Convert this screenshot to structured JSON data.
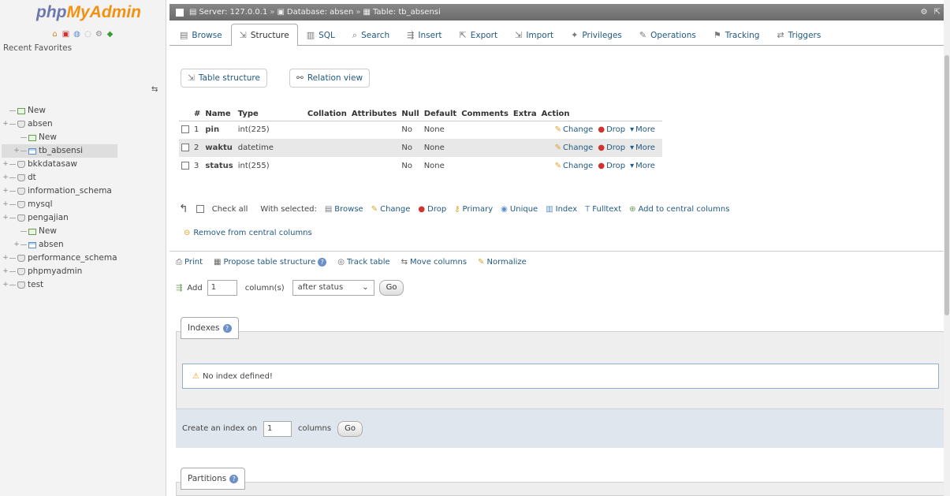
{
  "sidebar": {
    "logo_php": "php",
    "logo_myadmin": "MyAdmin",
    "recent_favorites": "Recent  Favorites",
    "collapse": "⇆",
    "tree": [
      {
        "label": "New",
        "type": "new",
        "indent": 0
      },
      {
        "label": "absen",
        "type": "db",
        "indent": 0
      },
      {
        "label": "New",
        "type": "new",
        "indent": 1
      },
      {
        "label": "tb_absensi",
        "type": "table",
        "indent": 1,
        "selected": true
      },
      {
        "label": "bkkdatasaw",
        "type": "db",
        "indent": 0
      },
      {
        "label": "dt",
        "type": "db",
        "indent": 0
      },
      {
        "label": "information_schema",
        "type": "db",
        "indent": 0
      },
      {
        "label": "mysql",
        "type": "db",
        "indent": 0
      },
      {
        "label": "pengajian",
        "type": "db",
        "indent": 0
      },
      {
        "label": "New",
        "type": "new",
        "indent": 1
      },
      {
        "label": "absen",
        "type": "table",
        "indent": 1
      },
      {
        "label": "performance_schema",
        "type": "db",
        "indent": 0
      },
      {
        "label": "phpmyadmin",
        "type": "db",
        "indent": 0
      },
      {
        "label": "test",
        "type": "db",
        "indent": 0
      }
    ]
  },
  "breadcrumb": {
    "server": "Server: 127.0.0.1",
    "database": "Database: absen",
    "table": "Table: tb_absensi"
  },
  "tabs": [
    {
      "label": "Browse",
      "icon": "▤",
      "active": false
    },
    {
      "label": "Structure",
      "icon": "⇲",
      "active": true
    },
    {
      "label": "SQL",
      "icon": "▥",
      "active": false
    },
    {
      "label": "Search",
      "icon": "⌕",
      "active": false
    },
    {
      "label": "Insert",
      "icon": "⇶",
      "active": false
    },
    {
      "label": "Export",
      "icon": "⇱",
      "active": false
    },
    {
      "label": "Import",
      "icon": "⇲",
      "active": false
    },
    {
      "label": "Privileges",
      "icon": "✦",
      "active": false
    },
    {
      "label": "Operations",
      "icon": "✎",
      "active": false
    },
    {
      "label": "Tracking",
      "icon": "⚑",
      "active": false
    },
    {
      "label": "Triggers",
      "icon": "⇄",
      "active": false
    }
  ],
  "subtabs": {
    "table_structure": "Table structure",
    "relation_view": "Relation view"
  },
  "structure": {
    "headers": [
      "#",
      "Name",
      "Type",
      "Collation",
      "Attributes",
      "Null",
      "Default",
      "Comments",
      "Extra",
      "Action"
    ],
    "rows": [
      {
        "num": "1",
        "name": "pin",
        "type": "int(225)",
        "collation": "",
        "attributes": "",
        "null": "No",
        "default": "None",
        "comments": "",
        "extra": ""
      },
      {
        "num": "2",
        "name": "waktu",
        "type": "datetime",
        "collation": "",
        "attributes": "",
        "null": "No",
        "default": "None",
        "comments": "",
        "extra": ""
      },
      {
        "num": "3",
        "name": "status",
        "type": "int(255)",
        "collation": "",
        "attributes": "",
        "null": "No",
        "default": "None",
        "comments": "",
        "extra": ""
      }
    ],
    "action_change": "Change",
    "action_drop": "Drop",
    "action_more": "More"
  },
  "with_selected": {
    "check_all": "Check all",
    "with_selected": "With selected:",
    "browse": "Browse",
    "change": "Change",
    "drop": "Drop",
    "primary": "Primary",
    "unique": "Unique",
    "index": "Index",
    "fulltext": "Fulltext",
    "add_central": "Add to central columns",
    "remove_central": "Remove from central columns"
  },
  "tools": {
    "print": "Print",
    "propose": "Propose table structure",
    "track": "Track table",
    "move_columns": "Move columns",
    "normalize": "Normalize"
  },
  "add_columns": {
    "add_label": "Add",
    "count": "1",
    "columns_label": "column(s)",
    "position": "after status",
    "go": "Go"
  },
  "indexes": {
    "legend": "Indexes",
    "no_index": "No index defined!",
    "create_label": "Create an index on",
    "create_count": "1",
    "columns_label": "columns",
    "go": "Go"
  },
  "partitions": {
    "legend": "Partitions"
  }
}
